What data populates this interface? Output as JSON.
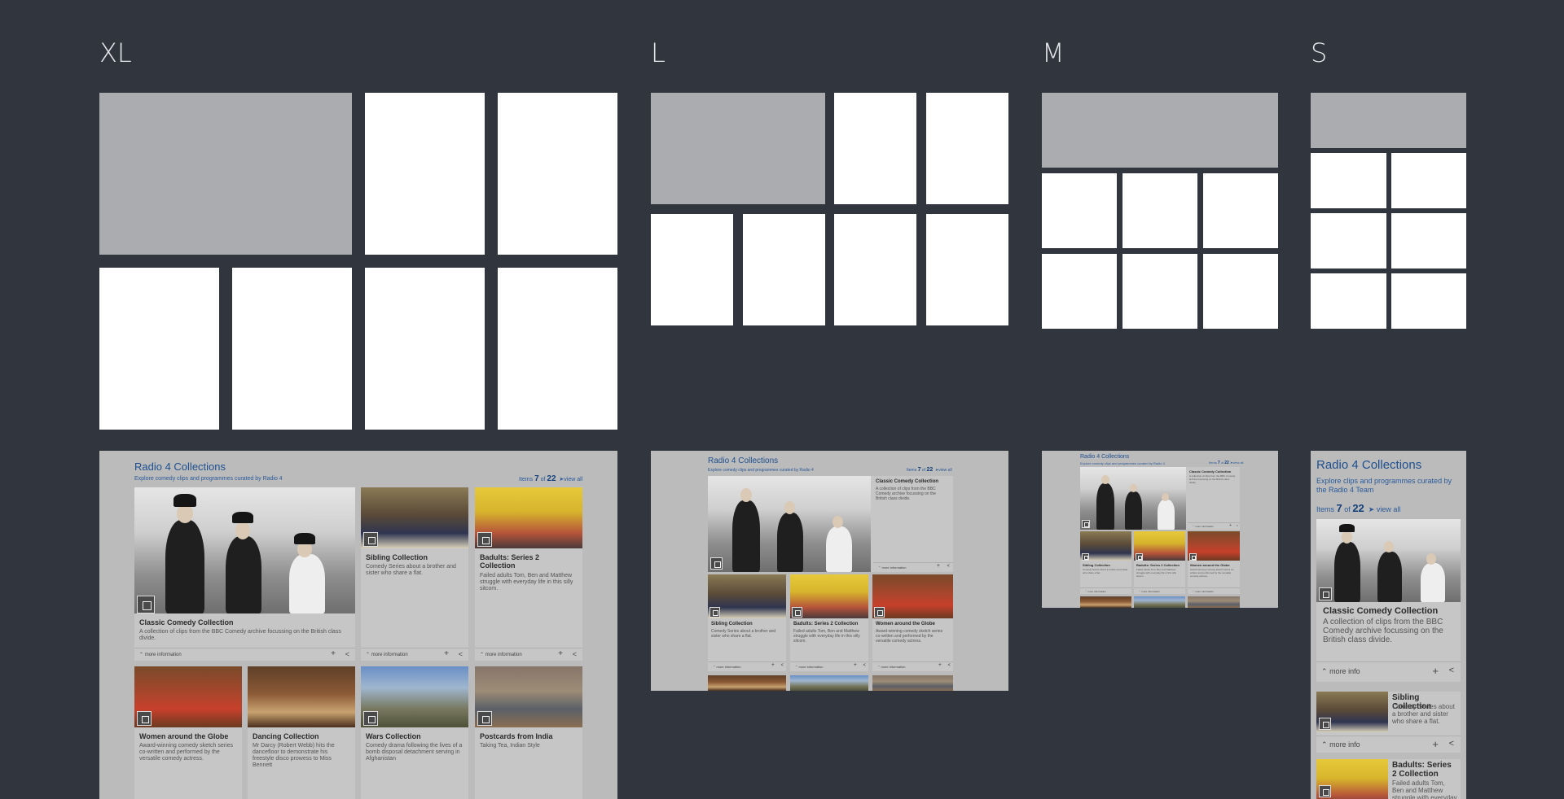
{
  "sizes": [
    "XL",
    "L",
    "M",
    "S"
  ],
  "mockup": {
    "title": "Radio 4 Collections",
    "subtitle": "Explore comedy clips and programmes curated by Radio 4",
    "subtitle_s": "Explore clips and programmes curated by the Radio 4 Team",
    "items_prefix": "Items",
    "items_current": "7",
    "items_of": "of",
    "items_total": "22",
    "view_all": "view all",
    "more_information": "more information",
    "more_info": "more info",
    "cards": [
      {
        "title": "Classic Comedy Collection",
        "desc": "A collection of clips from the BBC Comedy archive focussing on the British class divide."
      },
      {
        "title": "Sibling Collection",
        "desc": "Comedy Series about a brother and sister who share a flat."
      },
      {
        "title": "Badults: Series 2 Collection",
        "desc": "Failed adults Tom, Ben and Matthew struggle with everyday life in this silly sitcom."
      },
      {
        "title": "Women around the Globe",
        "desc": "Award-winning comedy sketch series co-written and performed by the versatile comedy actress."
      },
      {
        "title": "Dancing Collection",
        "desc": "Mr Darcy (Robert Webb) hits the dancefloor to demonstrate his freestyle disco prowess to Miss Bennett"
      },
      {
        "title": "Wars Collection",
        "desc": "Comedy drama following the lives of a bomb disposal detachment serving in Afghanistan"
      },
      {
        "title": "Postcards from India",
        "desc": "Taking Tea, Indian Style"
      }
    ]
  },
  "icons": {
    "badge": "gallery-icon",
    "plus": "plus-icon",
    "share": "share-icon",
    "more": "chevron-up-icon",
    "view_all": "chevron-right-icon"
  }
}
